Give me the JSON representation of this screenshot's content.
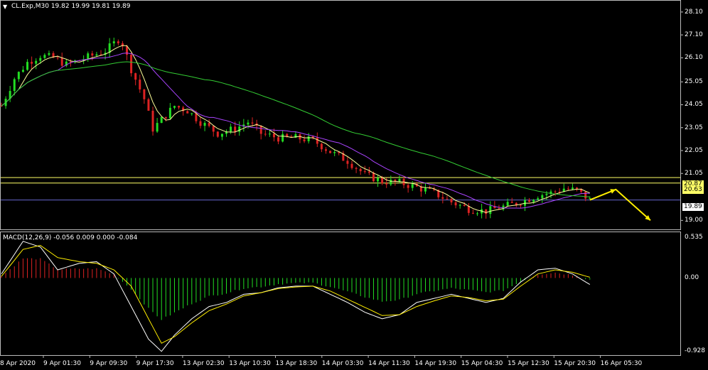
{
  "header": {
    "symbol_line": "CL.Exp,M30  19.82 19.99 19.81 19.89",
    "minimize_icon": "triangle-down-icon"
  },
  "price_axis": {
    "ticks": [
      "28.10",
      "27.10",
      "26.10",
      "25.05",
      "24.05",
      "23.05",
      "22.05",
      "21.05",
      "19.00"
    ],
    "tick_values": [
      28.1,
      27.1,
      26.1,
      25.05,
      24.05,
      23.05,
      22.05,
      21.05,
      19.0
    ],
    "labels": {
      "level_high": "20.87",
      "level_low": "20.63",
      "current": "19.89"
    },
    "range": [
      18.7,
      28.5
    ]
  },
  "macd": {
    "title": "MACD(12,26,9) -0.056 0.009 0.000 -0.084",
    "ticks": [
      "0.535",
      "0.00",
      "-0.928"
    ],
    "range": [
      -0.928,
      0.535
    ]
  },
  "time_axis": {
    "labels": [
      "8 Apr 2020",
      "9 Apr 01:30",
      "9 Apr 09:30",
      "9 Apr 17:30",
      "13 Apr 02:30",
      "13 Apr 10:30",
      "13 Apr 18:30",
      "14 Apr 03:30",
      "14 Apr 11:30",
      "14 Apr 19:30",
      "15 Apr 04:30",
      "15 Apr 12:30",
      "15 Apr 20:30",
      "16 Apr 05:30"
    ]
  },
  "colors": {
    "background": "#000000",
    "bull": "#22dd22",
    "bear": "#dd2222",
    "ma_fast": "#ffff99",
    "ma_mid": "#aa44ff",
    "ma_slow": "#33cc33",
    "macd_line": "#ffffff",
    "signal_line": "#ffee00",
    "level_line": "#ffff66",
    "arrow": "#ffee00",
    "current_line": "#6666cc"
  },
  "chart_data": [
    {
      "type": "candlestick",
      "title": "CL.Exp,M30",
      "close_path": [
        [
          0,
          24.0
        ],
        [
          3,
          25.2
        ],
        [
          6,
          25.9
        ],
        [
          9,
          26.2
        ],
        [
          12,
          26.1
        ],
        [
          15,
          25.8
        ],
        [
          18,
          26.0
        ],
        [
          21,
          26.2
        ],
        [
          24,
          26.4
        ],
        [
          27,
          26.9
        ],
        [
          28,
          26.7
        ],
        [
          30,
          25.6
        ],
        [
          33,
          24.3
        ],
        [
          35,
          23.0
        ],
        [
          37,
          23.4
        ],
        [
          40,
          24.0
        ],
        [
          43,
          23.8
        ],
        [
          46,
          23.3
        ],
        [
          50,
          22.8
        ],
        [
          54,
          23.0
        ],
        [
          57,
          23.3
        ],
        [
          60,
          22.8
        ],
        [
          64,
          22.6
        ],
        [
          68,
          22.6
        ],
        [
          72,
          22.5
        ],
        [
          76,
          22.0
        ],
        [
          80,
          21.6
        ],
        [
          84,
          21.0
        ],
        [
          88,
          20.7
        ],
        [
          92,
          20.65
        ],
        [
          96,
          20.45
        ],
        [
          100,
          20.2
        ],
        [
          104,
          19.8
        ],
        [
          108,
          19.5
        ],
        [
          112,
          19.4
        ],
        [
          116,
          19.6
        ],
        [
          120,
          19.8
        ],
        [
          124,
          20.1
        ],
        [
          127,
          20.2
        ],
        [
          130,
          20.4
        ],
        [
          133,
          20.3
        ],
        [
          136,
          19.89
        ]
      ],
      "levels": [
        20.87,
        20.63
      ],
      "current_price": 19.89,
      "projection": [
        [
          136,
          19.89
        ],
        [
          142,
          20.35
        ],
        [
          150,
          19.0
        ]
      ]
    },
    {
      "type": "macd",
      "title": "MACD(12,26,9)",
      "values": {
        "histogram": -0.056,
        "signal": 0.009,
        "extra": 0.0,
        "main": -0.084
      },
      "main_path": [
        [
          0,
          0.05
        ],
        [
          5,
          0.45
        ],
        [
          9,
          0.38
        ],
        [
          13,
          0.1
        ],
        [
          18,
          0.18
        ],
        [
          22,
          0.2
        ],
        [
          26,
          0.05
        ],
        [
          30,
          -0.35
        ],
        [
          34,
          -0.75
        ],
        [
          37,
          -0.9
        ],
        [
          40,
          -0.7
        ],
        [
          44,
          -0.5
        ],
        [
          48,
          -0.35
        ],
        [
          52,
          -0.3
        ],
        [
          56,
          -0.2
        ],
        [
          60,
          -0.18
        ],
        [
          64,
          -0.12
        ],
        [
          68,
          -0.1
        ],
        [
          72,
          -0.1
        ],
        [
          76,
          -0.2
        ],
        [
          80,
          -0.3
        ],
        [
          84,
          -0.42
        ],
        [
          88,
          -0.5
        ],
        [
          92,
          -0.45
        ],
        [
          96,
          -0.3
        ],
        [
          100,
          -0.25
        ],
        [
          104,
          -0.2
        ],
        [
          108,
          -0.25
        ],
        [
          112,
          -0.3
        ],
        [
          116,
          -0.25
        ],
        [
          120,
          -0.05
        ],
        [
          124,
          0.1
        ],
        [
          128,
          0.12
        ],
        [
          132,
          0.05
        ],
        [
          136,
          -0.08
        ]
      ],
      "signal_path": [
        [
          0,
          0.02
        ],
        [
          5,
          0.35
        ],
        [
          9,
          0.4
        ],
        [
          13,
          0.25
        ],
        [
          18,
          0.2
        ],
        [
          22,
          0.18
        ],
        [
          26,
          0.1
        ],
        [
          30,
          -0.1
        ],
        [
          34,
          -0.5
        ],
        [
          37,
          -0.8
        ],
        [
          40,
          -0.72
        ],
        [
          44,
          -0.55
        ],
        [
          48,
          -0.4
        ],
        [
          52,
          -0.32
        ],
        [
          56,
          -0.22
        ],
        [
          60,
          -0.18
        ],
        [
          64,
          -0.13
        ],
        [
          68,
          -0.11
        ],
        [
          72,
          -0.1
        ],
        [
          76,
          -0.16
        ],
        [
          80,
          -0.26
        ],
        [
          84,
          -0.36
        ],
        [
          88,
          -0.46
        ],
        [
          92,
          -0.45
        ],
        [
          96,
          -0.35
        ],
        [
          100,
          -0.28
        ],
        [
          104,
          -0.22
        ],
        [
          108,
          -0.24
        ],
        [
          112,
          -0.28
        ],
        [
          116,
          -0.26
        ],
        [
          120,
          -0.1
        ],
        [
          124,
          0.05
        ],
        [
          128,
          0.1
        ],
        [
          132,
          0.07
        ],
        [
          136,
          0.009
        ]
      ]
    }
  ]
}
